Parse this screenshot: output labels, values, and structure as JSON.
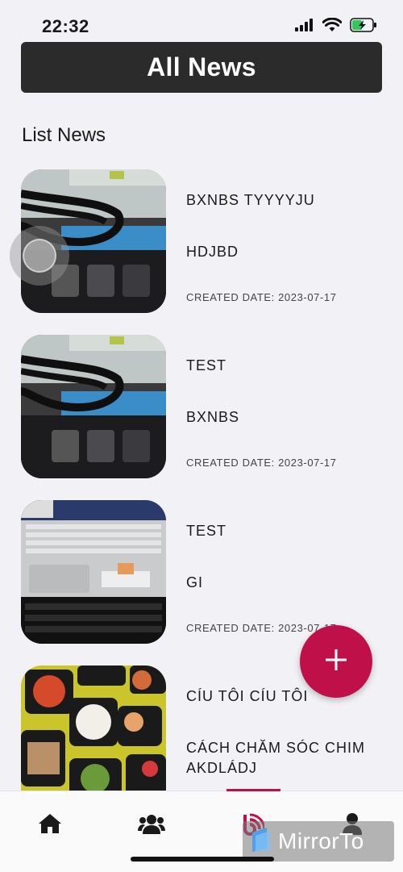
{
  "status_bar": {
    "time": "22:32"
  },
  "header": {
    "title": "All News"
  },
  "section": {
    "title": "List News"
  },
  "news": [
    {
      "title": "BXNBS TYYYYJU",
      "description": "HDJBD",
      "date": "CREATED DATE: 2023-07-17"
    },
    {
      "title": "TEST",
      "description": "BXNBS",
      "date": "CREATED DATE: 2023-07-17"
    },
    {
      "title": "TEST",
      "description": "GI",
      "date": "CREATED DATE: 2023-07-17"
    },
    {
      "title": "CÍU TÔI CÍU TÔI",
      "description": "CÁCH CHĂM SÓC CHIM AKDLÁDJ",
      "date": ""
    }
  ],
  "tabs": [
    {
      "icon": "home-icon"
    },
    {
      "icon": "users-icon"
    },
    {
      "icon": "news-icon",
      "active": true
    },
    {
      "icon": "profile-icon"
    }
  ],
  "watermark": {
    "text": "MirrorTo"
  },
  "colors": {
    "accent": "#c0104a",
    "header_bg": "#2b2b2b",
    "background": "#f2f1f5"
  }
}
